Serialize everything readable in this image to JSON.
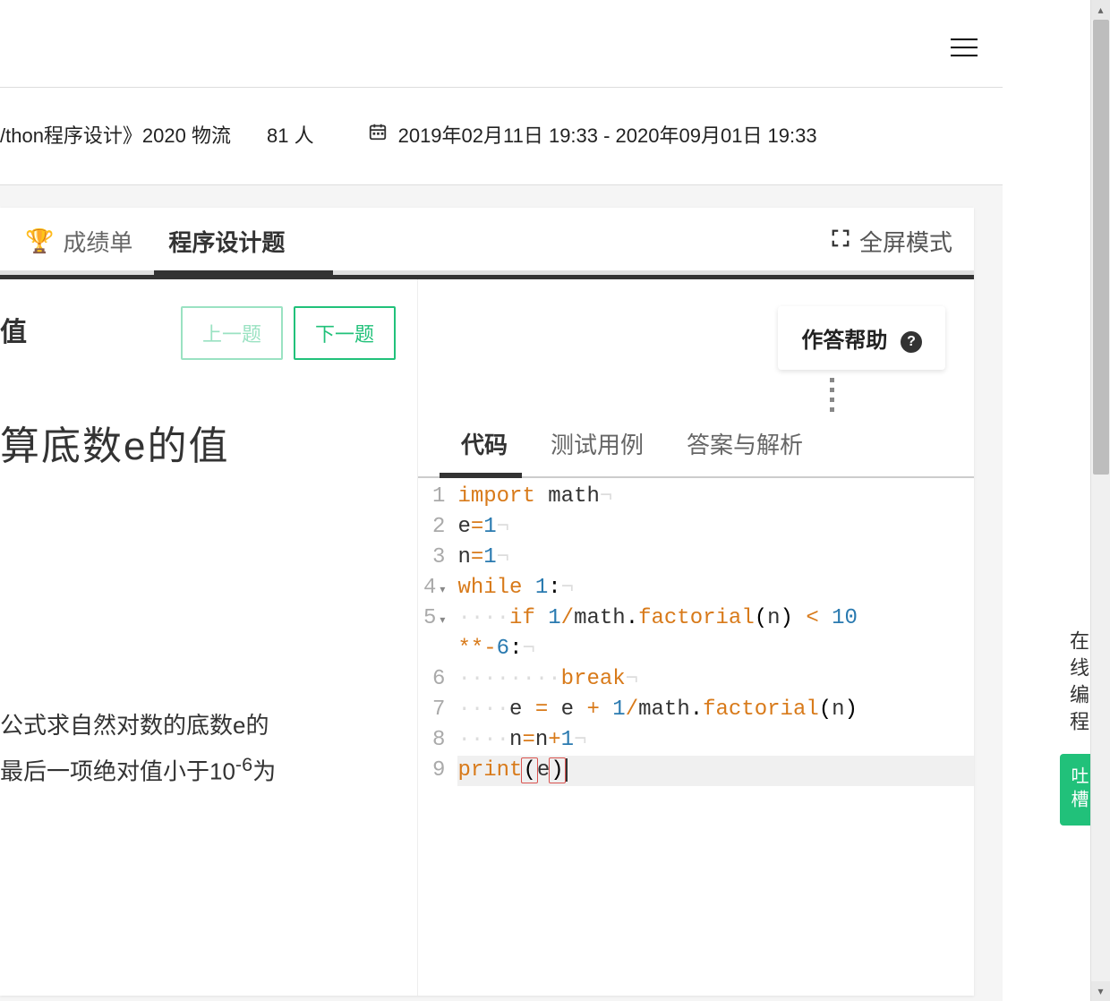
{
  "header": {
    "course_name": "/thon程序设计》2020 物流",
    "people_count": "81 人",
    "date_range": "2019年02月11日 19:33 - 2020年09月01日 19:33"
  },
  "top_tabs": {
    "scoreboard": "成绩单",
    "programming": "程序设计题",
    "fullscreen": "全屏模式"
  },
  "problem": {
    "truncated_header": "值",
    "prev_btn": "上一题",
    "next_btn": "下一题",
    "title": "算底数e的值",
    "desc_line1": "公式求自然对数的底数e的",
    "desc_line2_prefix": "最后一项绝对值小于10",
    "desc_line2_exp": "-6",
    "desc_line2_suffix": "为"
  },
  "right": {
    "help_btn": "作答帮助",
    "code_tabs": {
      "code": "代码",
      "testcase": "测试用例",
      "answer": "答案与解析"
    },
    "code_lines": [
      "import math",
      "e=1",
      "n=1",
      "while 1:",
      "    if 1/math.factorial(n) < 10**-6:",
      "        break",
      "    e = e + 1/math.factorial(n)",
      "    n=n+1",
      "print(e)"
    ]
  },
  "side": {
    "online_label": "在线编程",
    "tucao": "吐槽"
  }
}
